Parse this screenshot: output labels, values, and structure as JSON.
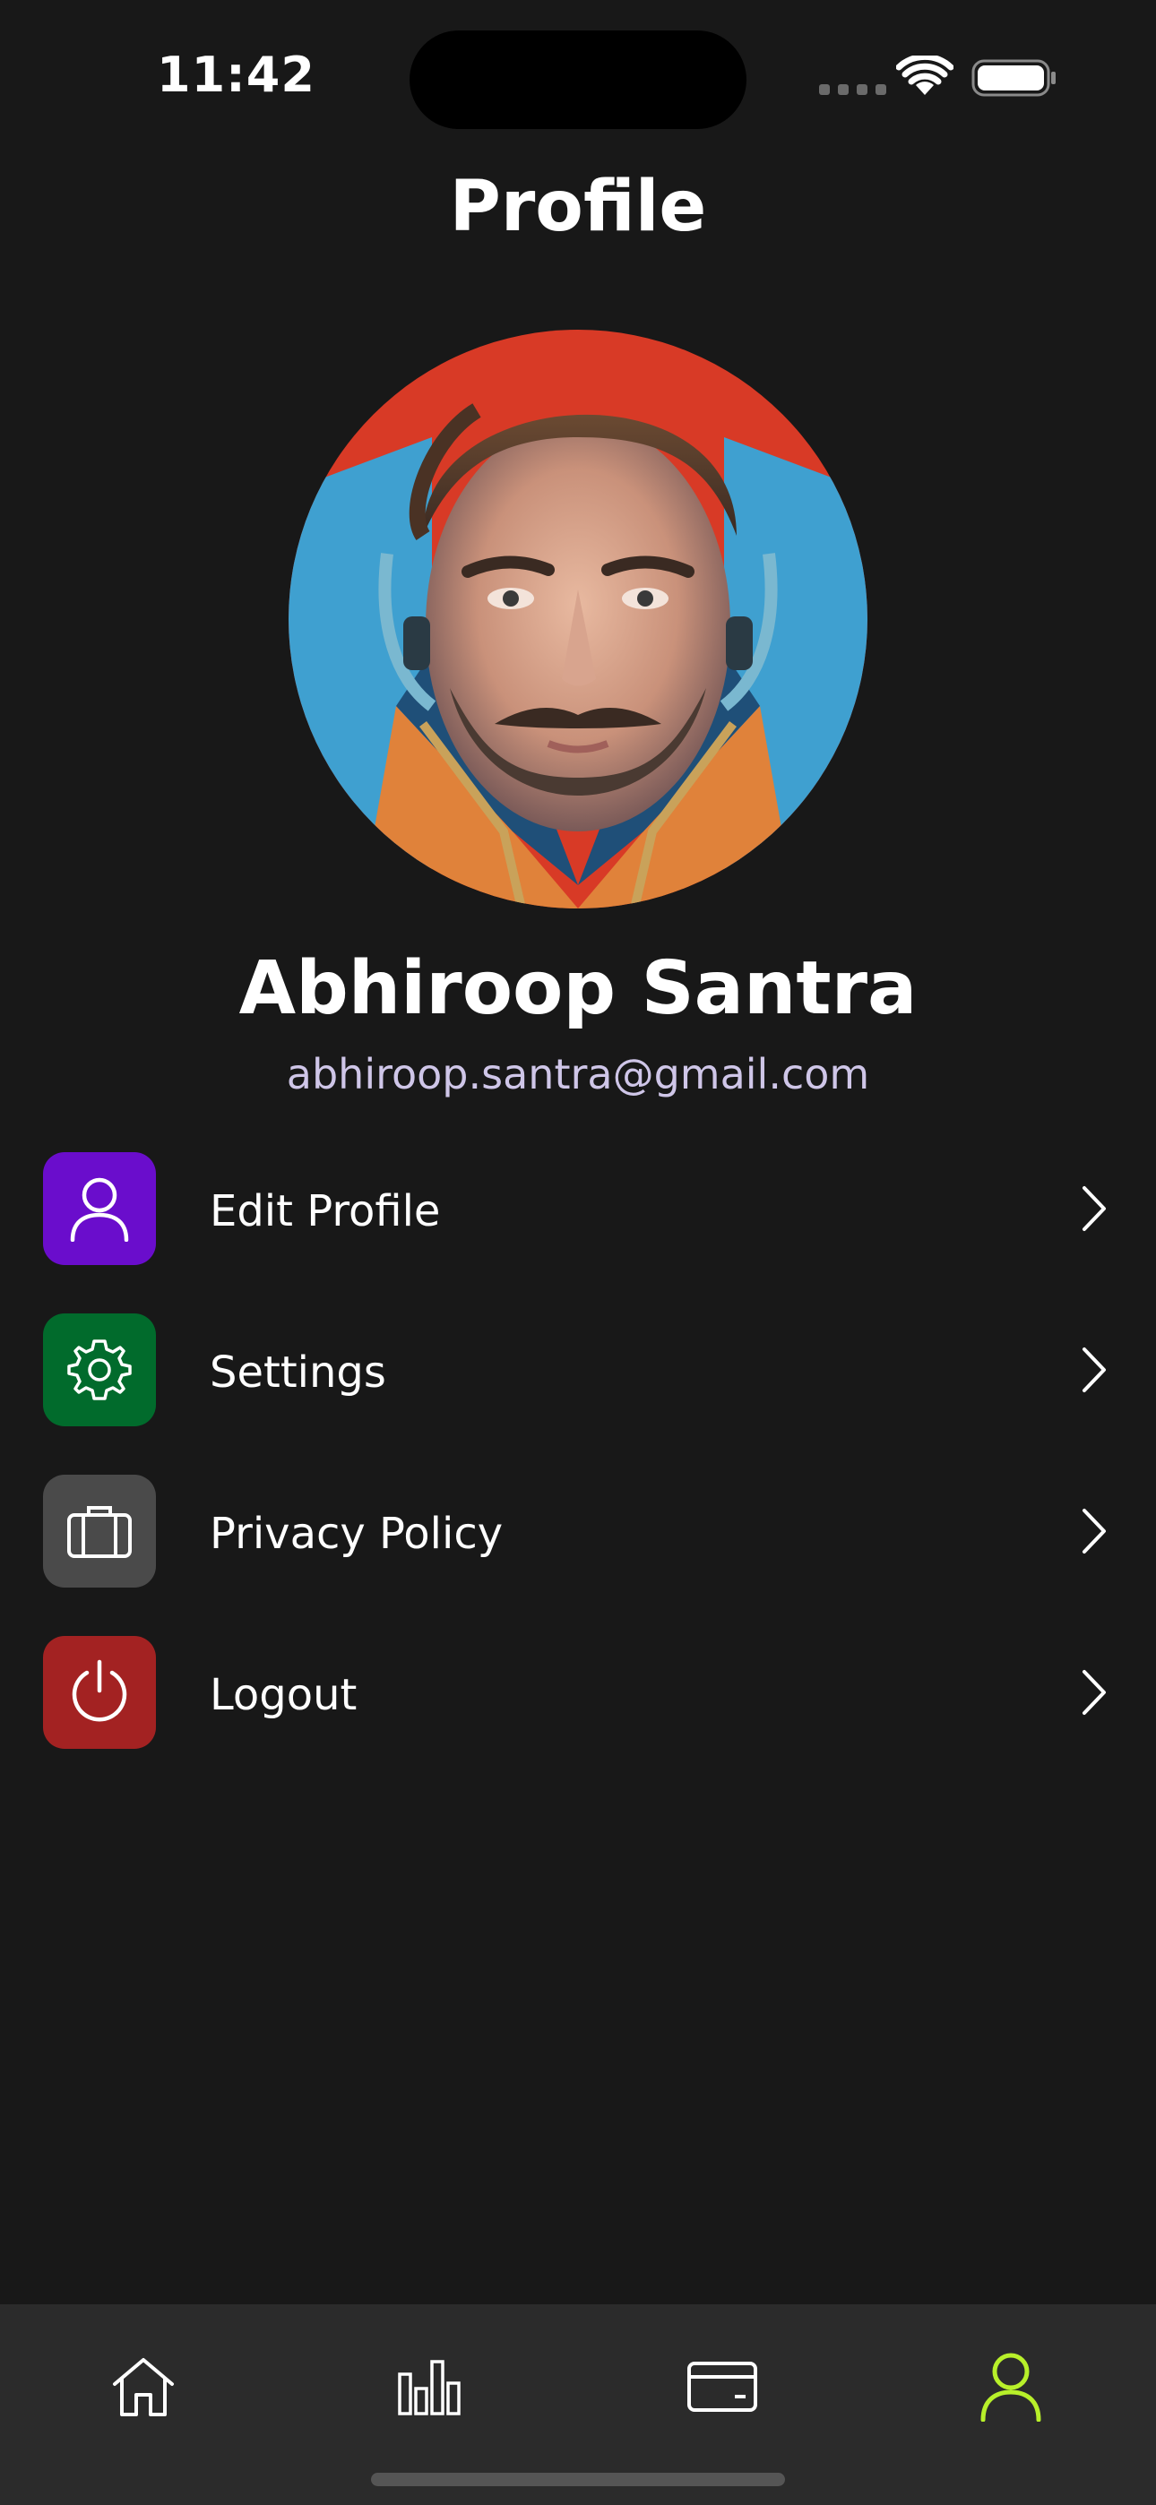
{
  "status_bar": {
    "time": "11:42"
  },
  "header": {
    "title": "Profile"
  },
  "profile": {
    "name": "Abhiroop Santra",
    "email": "abhiroop.santra@gmail.com"
  },
  "menu": {
    "items": [
      {
        "label": "Edit Profile",
        "icon": "user-icon",
        "color": "#6a0dcc"
      },
      {
        "label": "Settings",
        "icon": "gear-icon",
        "color": "#016b2c"
      },
      {
        "label": "Privacy Policy",
        "icon": "briefcase-icon",
        "color": "#4a4a4a"
      },
      {
        "label": "Logout",
        "icon": "power-icon",
        "color": "#a32222"
      }
    ]
  },
  "tab_bar": {
    "tabs": [
      {
        "icon": "home-icon",
        "active": false
      },
      {
        "icon": "bar-chart-icon",
        "active": false
      },
      {
        "icon": "card-icon",
        "active": false
      },
      {
        "icon": "user-icon",
        "active": true
      }
    ],
    "active_color": "#b8f02a",
    "inactive_color": "#ffffff"
  }
}
